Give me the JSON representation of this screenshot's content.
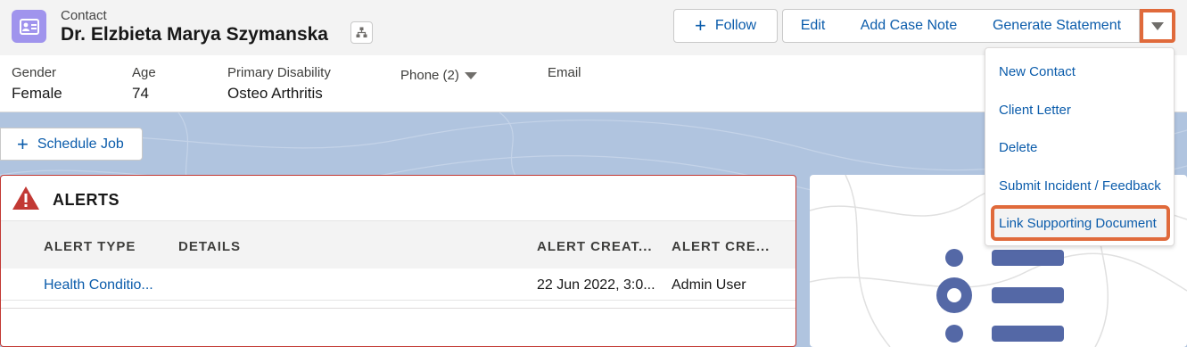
{
  "header": {
    "object_label": "Contact",
    "record_name": "Dr. Elzbieta Marya Szymanska",
    "icons": {
      "object": "contact-card-icon",
      "hierarchy": "hierarchy-icon"
    },
    "buttons": {
      "follow": "Follow",
      "edit": "Edit",
      "add_case_note": "Add Case Note",
      "generate_statement": "Generate Statement",
      "more": "chevron-down-icon"
    }
  },
  "highlights": {
    "fields": [
      {
        "label": "Gender",
        "value": "Female"
      },
      {
        "label": "Age",
        "value": "74"
      },
      {
        "label": "Primary Disability",
        "value": "Osteo Arthritis"
      },
      {
        "label": "Phone (2)",
        "value": ""
      },
      {
        "label": "Email",
        "value": ""
      }
    ]
  },
  "schedule_job": {
    "label": "Schedule Job"
  },
  "alerts": {
    "title": "ALERTS",
    "columns": [
      "ALERT TYPE",
      "DETAILS",
      "ALERT CREAT...",
      "ALERT CRE..."
    ],
    "rows": [
      {
        "alert_type": "Health Conditio...",
        "details": "",
        "created_date": "22 Jun 2022, 3:0...",
        "created_by": "Admin User"
      }
    ]
  },
  "dropdown": {
    "items": [
      "New Contact",
      "Client Letter",
      "Delete",
      "Submit Incident / Feedback",
      "Link Supporting Document"
    ],
    "highlighted": "Link Supporting Document"
  },
  "colors": {
    "accent": "#0b5cab",
    "highlight_outline": "#e06a3b",
    "alert_red": "#c23934",
    "contact_icon": "#a094ed",
    "background": "#b0c4df"
  }
}
